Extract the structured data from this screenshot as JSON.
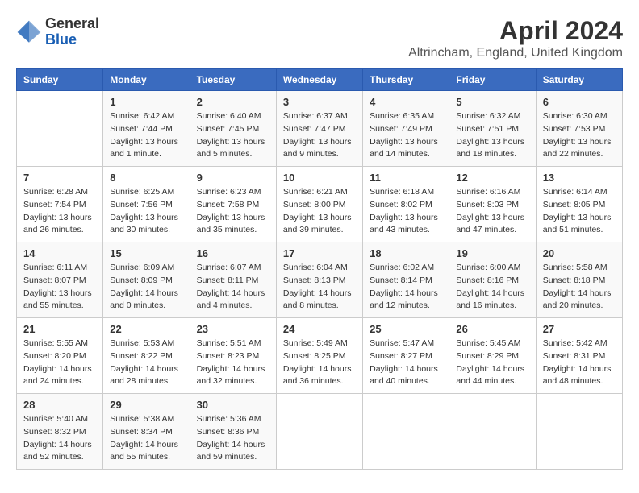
{
  "logo": {
    "line1": "General",
    "line2": "Blue"
  },
  "title": "April 2024",
  "subtitle": "Altrincham, England, United Kingdom",
  "header_days": [
    "Sunday",
    "Monday",
    "Tuesday",
    "Wednesday",
    "Thursday",
    "Friday",
    "Saturday"
  ],
  "weeks": [
    [
      {
        "day": "",
        "info": ""
      },
      {
        "day": "1",
        "info": "Sunrise: 6:42 AM\nSunset: 7:44 PM\nDaylight: 13 hours\nand 1 minute."
      },
      {
        "day": "2",
        "info": "Sunrise: 6:40 AM\nSunset: 7:45 PM\nDaylight: 13 hours\nand 5 minutes."
      },
      {
        "day": "3",
        "info": "Sunrise: 6:37 AM\nSunset: 7:47 PM\nDaylight: 13 hours\nand 9 minutes."
      },
      {
        "day": "4",
        "info": "Sunrise: 6:35 AM\nSunset: 7:49 PM\nDaylight: 13 hours\nand 14 minutes."
      },
      {
        "day": "5",
        "info": "Sunrise: 6:32 AM\nSunset: 7:51 PM\nDaylight: 13 hours\nand 18 minutes."
      },
      {
        "day": "6",
        "info": "Sunrise: 6:30 AM\nSunset: 7:53 PM\nDaylight: 13 hours\nand 22 minutes."
      }
    ],
    [
      {
        "day": "7",
        "info": "Sunrise: 6:28 AM\nSunset: 7:54 PM\nDaylight: 13 hours\nand 26 minutes."
      },
      {
        "day": "8",
        "info": "Sunrise: 6:25 AM\nSunset: 7:56 PM\nDaylight: 13 hours\nand 30 minutes."
      },
      {
        "day": "9",
        "info": "Sunrise: 6:23 AM\nSunset: 7:58 PM\nDaylight: 13 hours\nand 35 minutes."
      },
      {
        "day": "10",
        "info": "Sunrise: 6:21 AM\nSunset: 8:00 PM\nDaylight: 13 hours\nand 39 minutes."
      },
      {
        "day": "11",
        "info": "Sunrise: 6:18 AM\nSunset: 8:02 PM\nDaylight: 13 hours\nand 43 minutes."
      },
      {
        "day": "12",
        "info": "Sunrise: 6:16 AM\nSunset: 8:03 PM\nDaylight: 13 hours\nand 47 minutes."
      },
      {
        "day": "13",
        "info": "Sunrise: 6:14 AM\nSunset: 8:05 PM\nDaylight: 13 hours\nand 51 minutes."
      }
    ],
    [
      {
        "day": "14",
        "info": "Sunrise: 6:11 AM\nSunset: 8:07 PM\nDaylight: 13 hours\nand 55 minutes."
      },
      {
        "day": "15",
        "info": "Sunrise: 6:09 AM\nSunset: 8:09 PM\nDaylight: 14 hours\nand 0 minutes."
      },
      {
        "day": "16",
        "info": "Sunrise: 6:07 AM\nSunset: 8:11 PM\nDaylight: 14 hours\nand 4 minutes."
      },
      {
        "day": "17",
        "info": "Sunrise: 6:04 AM\nSunset: 8:13 PM\nDaylight: 14 hours\nand 8 minutes."
      },
      {
        "day": "18",
        "info": "Sunrise: 6:02 AM\nSunset: 8:14 PM\nDaylight: 14 hours\nand 12 minutes."
      },
      {
        "day": "19",
        "info": "Sunrise: 6:00 AM\nSunset: 8:16 PM\nDaylight: 14 hours\nand 16 minutes."
      },
      {
        "day": "20",
        "info": "Sunrise: 5:58 AM\nSunset: 8:18 PM\nDaylight: 14 hours\nand 20 minutes."
      }
    ],
    [
      {
        "day": "21",
        "info": "Sunrise: 5:55 AM\nSunset: 8:20 PM\nDaylight: 14 hours\nand 24 minutes."
      },
      {
        "day": "22",
        "info": "Sunrise: 5:53 AM\nSunset: 8:22 PM\nDaylight: 14 hours\nand 28 minutes."
      },
      {
        "day": "23",
        "info": "Sunrise: 5:51 AM\nSunset: 8:23 PM\nDaylight: 14 hours\nand 32 minutes."
      },
      {
        "day": "24",
        "info": "Sunrise: 5:49 AM\nSunset: 8:25 PM\nDaylight: 14 hours\nand 36 minutes."
      },
      {
        "day": "25",
        "info": "Sunrise: 5:47 AM\nSunset: 8:27 PM\nDaylight: 14 hours\nand 40 minutes."
      },
      {
        "day": "26",
        "info": "Sunrise: 5:45 AM\nSunset: 8:29 PM\nDaylight: 14 hours\nand 44 minutes."
      },
      {
        "day": "27",
        "info": "Sunrise: 5:42 AM\nSunset: 8:31 PM\nDaylight: 14 hours\nand 48 minutes."
      }
    ],
    [
      {
        "day": "28",
        "info": "Sunrise: 5:40 AM\nSunset: 8:32 PM\nDaylight: 14 hours\nand 52 minutes."
      },
      {
        "day": "29",
        "info": "Sunrise: 5:38 AM\nSunset: 8:34 PM\nDaylight: 14 hours\nand 55 minutes."
      },
      {
        "day": "30",
        "info": "Sunrise: 5:36 AM\nSunset: 8:36 PM\nDaylight: 14 hours\nand 59 minutes."
      },
      {
        "day": "",
        "info": ""
      },
      {
        "day": "",
        "info": ""
      },
      {
        "day": "",
        "info": ""
      },
      {
        "day": "",
        "info": ""
      }
    ]
  ]
}
